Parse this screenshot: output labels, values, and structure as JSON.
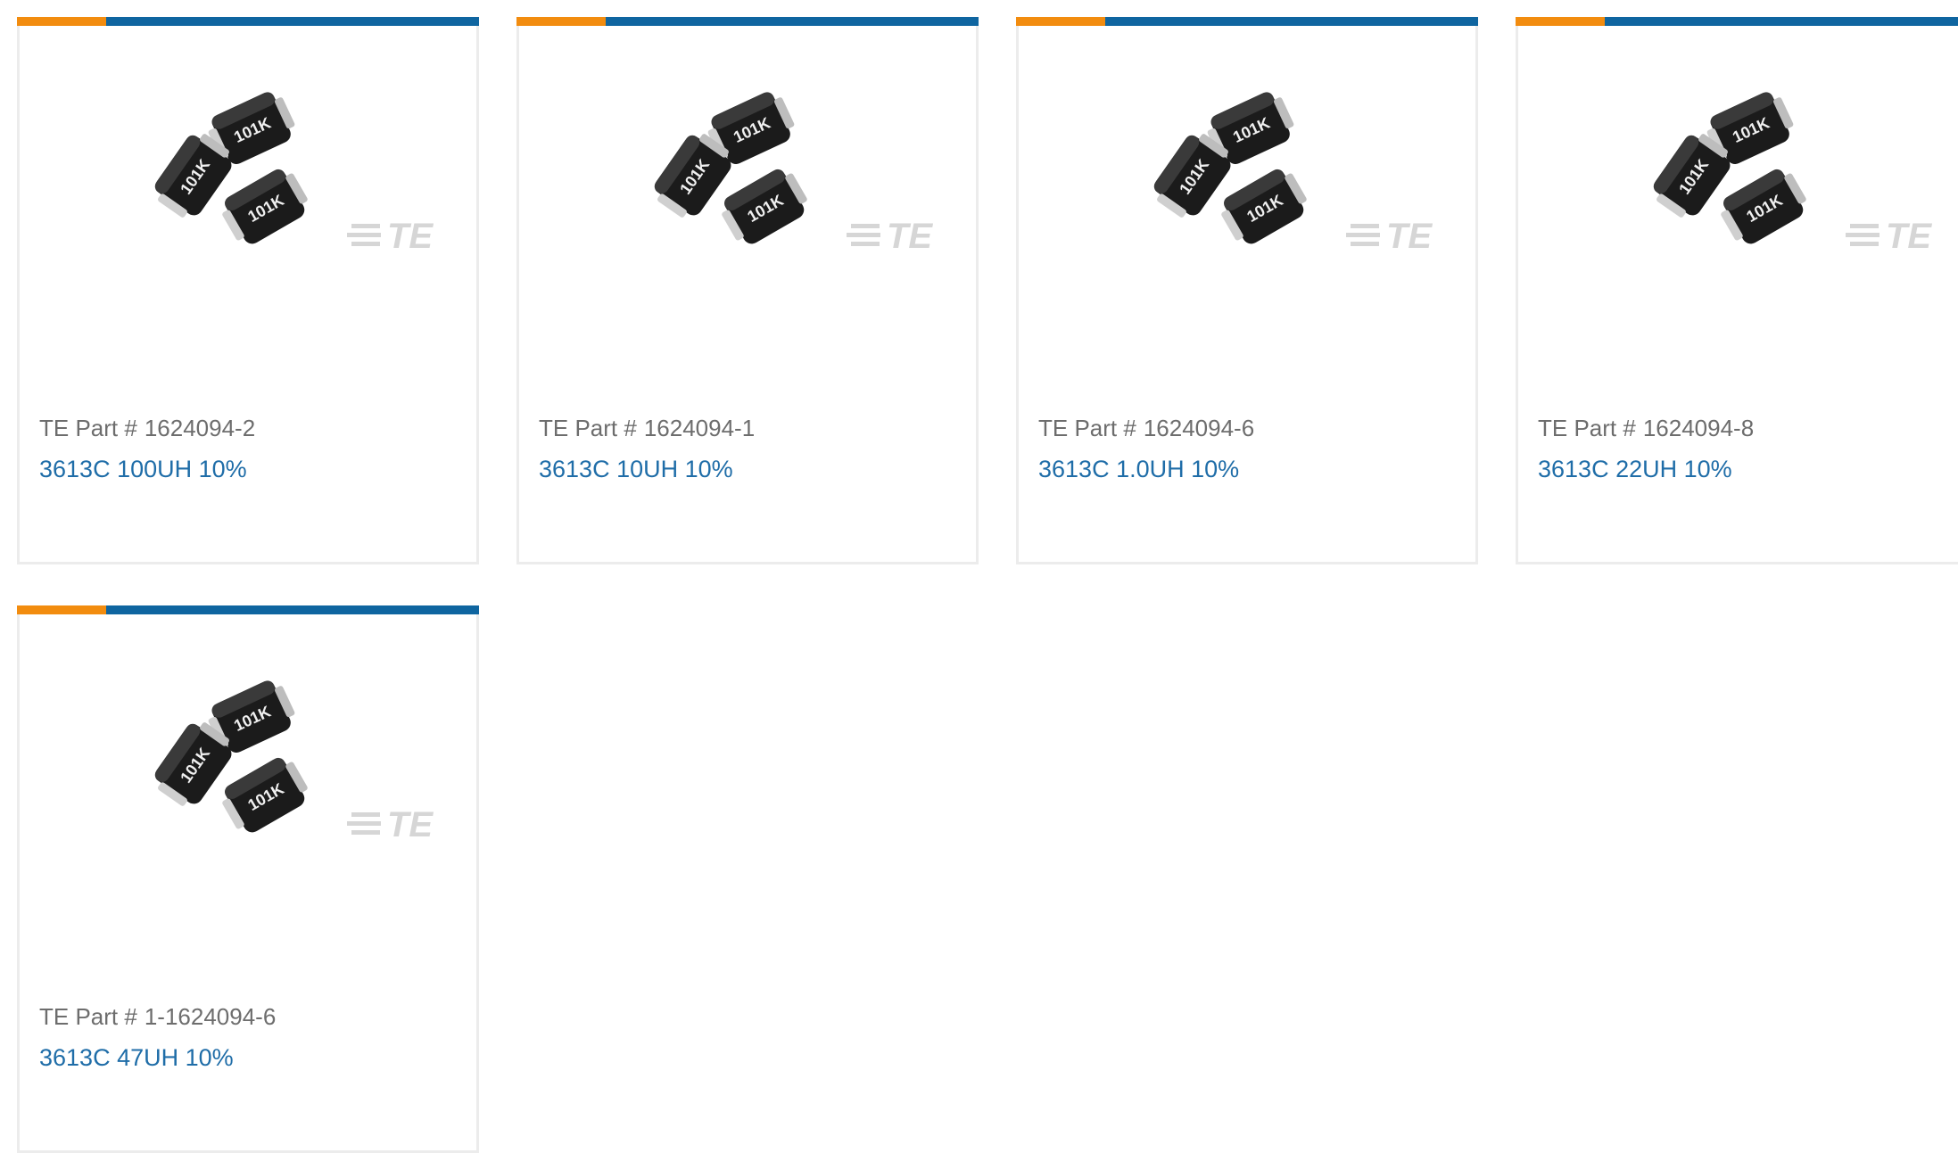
{
  "colors": {
    "accent_orange": "#f28c0f",
    "accent_blue": "#0f65a0",
    "link": "#1f6da8",
    "muted_text": "#6d6d6d"
  },
  "cards": [
    {
      "part_prefix": "TE Part #",
      "part_number": "1624094-2",
      "title": "3613C 100UH 10%",
      "image_icon": "inductor-product-image",
      "logo": "TE"
    },
    {
      "part_prefix": "TE Part #",
      "part_number": "1624094-1",
      "title": "3613C 10UH 10%",
      "image_icon": "inductor-product-image",
      "logo": "TE"
    },
    {
      "part_prefix": "TE Part #",
      "part_number": "1624094-6",
      "title": "3613C 1.0UH 10%",
      "image_icon": "inductor-product-image",
      "logo": "TE"
    },
    {
      "part_prefix": "TE Part #",
      "part_number": "1624094-8",
      "title": "3613C 22UH 10%",
      "image_icon": "inductor-product-image",
      "logo": "TE"
    },
    {
      "part_prefix": "TE Part #",
      "part_number": "1-1624094-6",
      "title": "3613C 47UH 10%",
      "image_icon": "inductor-product-image",
      "logo": "TE"
    }
  ]
}
